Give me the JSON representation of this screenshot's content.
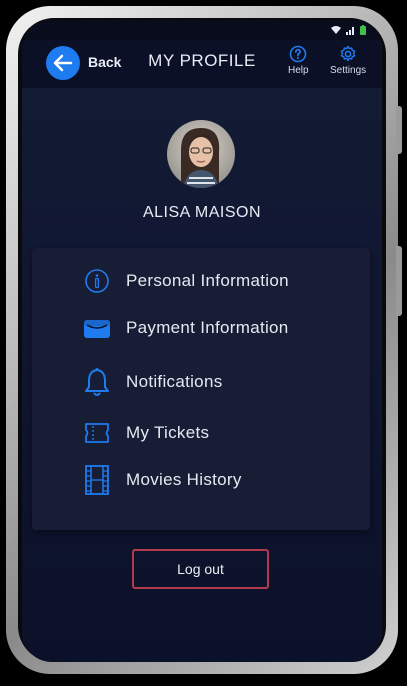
{
  "header": {
    "back_label": "Back",
    "title": "MY PROFILE",
    "help_label": "Help",
    "settings_label": "Settings"
  },
  "profile": {
    "name": "ALISA MAISON"
  },
  "menu": {
    "items": [
      {
        "label": "Personal Information",
        "icon": "info-circle-icon"
      },
      {
        "label": "Payment Information",
        "icon": "wallet-icon"
      },
      {
        "label": "Notifications",
        "icon": "bell-icon"
      },
      {
        "label": "My Tickets",
        "icon": "ticket-icon"
      },
      {
        "label": "Movies History",
        "icon": "film-strip-icon"
      }
    ]
  },
  "logout_label": "Log out",
  "colors": {
    "accent": "#1e7bf0",
    "background": "#101733",
    "card": "#161d35",
    "logout_border": "#b23a4c"
  }
}
